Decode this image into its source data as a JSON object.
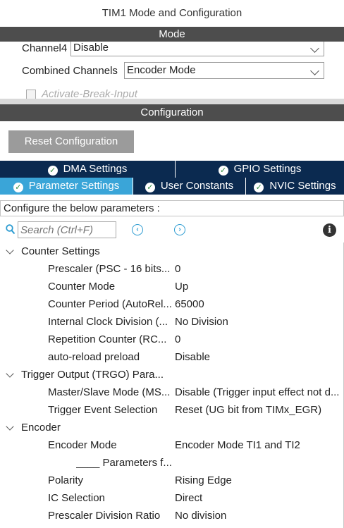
{
  "window": {
    "title": "TIM1 Mode and Configuration"
  },
  "mode": {
    "header": "Mode",
    "channel4": {
      "label": "Channel4",
      "value": "Disable"
    },
    "combined": {
      "label": "Combined Channels",
      "value": "Encoder Mode"
    },
    "activate_break": {
      "label": "Activate-Break-Input"
    }
  },
  "configuration": {
    "header": "Configuration",
    "reset_label": "Reset Configuration",
    "tabs_row1": [
      {
        "label": "DMA Settings",
        "icon": "check-circle-icon"
      },
      {
        "label": "GPIO Settings",
        "icon": "check-circle-icon"
      }
    ],
    "tabs_row2": [
      {
        "label": "Parameter Settings",
        "icon": "check-circle-icon",
        "active": true
      },
      {
        "label": "User Constants",
        "icon": "check-circle-icon"
      },
      {
        "label": "NVIC Settings",
        "icon": "check-circle-icon"
      }
    ],
    "description": "Configure the below parameters :",
    "search": {
      "placeholder": "Search (Ctrl+F)"
    },
    "groups": [
      {
        "label": "Counter Settings",
        "params": [
          {
            "label": "Prescaler (PSC - 16 bits...",
            "value": "0"
          },
          {
            "label": "Counter Mode",
            "value": "Up"
          },
          {
            "label": "Counter Period (AutoRel...",
            "value": "65000"
          },
          {
            "label": "Internal Clock Division (...",
            "value": "No Division"
          },
          {
            "label": "Repetition Counter (RC...",
            "value": "0"
          },
          {
            "label": "auto-reload preload",
            "value": "Disable"
          }
        ]
      },
      {
        "label": "Trigger Output (TRGO) Para...",
        "params": [
          {
            "label": "Master/Slave Mode (MS...",
            "value": "Disable (Trigger input effect not d..."
          },
          {
            "label": "Trigger Event Selection",
            "value": "Reset (UG bit from TIMx_EGR)"
          }
        ]
      },
      {
        "label": "Encoder",
        "params": [
          {
            "label": "Encoder Mode",
            "value": "Encoder Mode TI1 and TI2"
          },
          {
            "label": "____ Parameters f...",
            "value": "",
            "sub": true
          },
          {
            "label": "Polarity",
            "value": "Rising Edge"
          },
          {
            "label": "IC Selection",
            "value": "Direct"
          },
          {
            "label": "Prescaler Division Ratio",
            "value": "No division"
          }
        ]
      }
    ]
  }
}
